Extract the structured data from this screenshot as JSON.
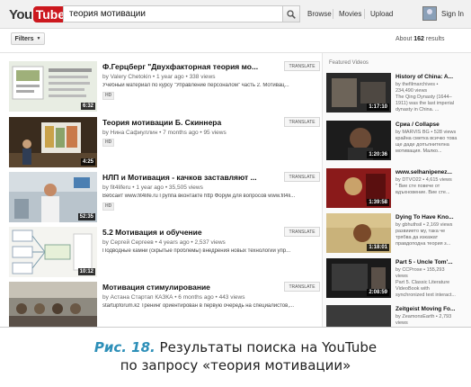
{
  "masthead": {
    "logo_you": "You",
    "logo_tube": "Tube",
    "search_value": "теория мотивации",
    "nav": [
      "Browse",
      "Movies",
      "Upload"
    ],
    "sign_in": "Sign In"
  },
  "toolbar": {
    "filters_label": "Filters",
    "results_prefix": "About ",
    "results_count": "162",
    "results_suffix": " results"
  },
  "results": [
    {
      "title": "Ф.Герцберг \"Двухфакторная теория мо...",
      "meta": "by Valery Chetokin • 1 year ago • 338 views",
      "desc": "Учебный материал по курсу \"Управление персоналом\" часть 2. Мотивац...",
      "duration": "6:32",
      "translate": "TRANSLATE",
      "hd": "HD"
    },
    {
      "title": "Теория мотивации Б. Скиннера",
      "meta": "by Нина Сафиуллин • 7 months ago • 95 views",
      "desc": "",
      "duration": "4:25",
      "translate": "TRANSLATE",
      "hd": "HD"
    },
    {
      "title": "НЛП и Мотивация - качков заставляют ...",
      "meta": "by fit4liferu • 1 year ago • 35,505 views",
      "desc": "Вебсайт www.fit4life.ru Группа вконтакте http Форум для вопросов www.fit4li...",
      "duration": "52:35",
      "translate": "TRANSLATE",
      "hd": "HD"
    },
    {
      "title": "5.2 Мотивация и обучение",
      "meta": "by Сергей Сергеев • 4 years ago • 2,537 views",
      "desc": "Подводные камни (скрытые проблемы) внедрения новых технологий упр...",
      "duration": "10:12",
      "translate": "TRANSLATE",
      "hd": ""
    },
    {
      "title": "Мотивация стимулирование",
      "meta": "by Астана Стартап КАЗКА • 6 months ago • 443 views",
      "desc": "startupforum.kz Тренинг ориентирован в первую очередь на специалистов,...",
      "duration": "",
      "translate": "TRANSLATE",
      "hd": ""
    }
  ],
  "sidebar": {
    "heading": "Featured Videos",
    "items": [
      {
        "title": "History of China: A...",
        "line1": "by thefilmarchives •",
        "line2": "234,490 views",
        "line3": "The Qing Dynasty (1644–",
        "line4": "1911) was the last imperial",
        "line5": "dynasty in China. ...",
        "duration": "1:17:10"
      },
      {
        "title": "Сриа / Collapse",
        "line1": "by MARVIS BG • 528 views",
        "line2": "крайна сметка всичко това",
        "line3": "ще даде допълнителна",
        "line4": "мотивация. Малко...",
        "line5": "",
        "duration": "1:20:36"
      },
      {
        "title": "www.selhanipenez...",
        "line1": "by DTVO22 • 4,615 views",
        "line2": "\" Вие сте повече от",
        "line3": "вдъхновение. Вие сте...",
        "line4": "",
        "line5": "",
        "duration": "1:39:58"
      },
      {
        "title": "Dying To Have Kno...",
        "line1": "by gbhuthsil • 2,169 views",
        "line2": "развиието му, така че",
        "line3": "трябва да изкажат",
        "line4": "правдоподна теория з...",
        "line5": "",
        "duration": "1:18:01"
      },
      {
        "title": "Part 5 - Uncle Tom'...",
        "line1": "by CCProse • 155,293",
        "line2": "views",
        "line3": "Part 5. Classic Literature",
        "line4": "VideoBook with",
        "line5": "synchronized text interact...",
        "duration": "2:08:59"
      },
      {
        "title": "Zeitgeist Moving Fo...",
        "line1": "by ZeamonsEarth • 2,793",
        "line2": "views",
        "line3": "",
        "line4": "",
        "line5": "",
        "duration": ""
      }
    ]
  },
  "caption": {
    "fig_label": "Рис. 18.",
    "line1": " Результаты поиска на YouTube",
    "line2": "по запросу «теория мотивации»"
  }
}
